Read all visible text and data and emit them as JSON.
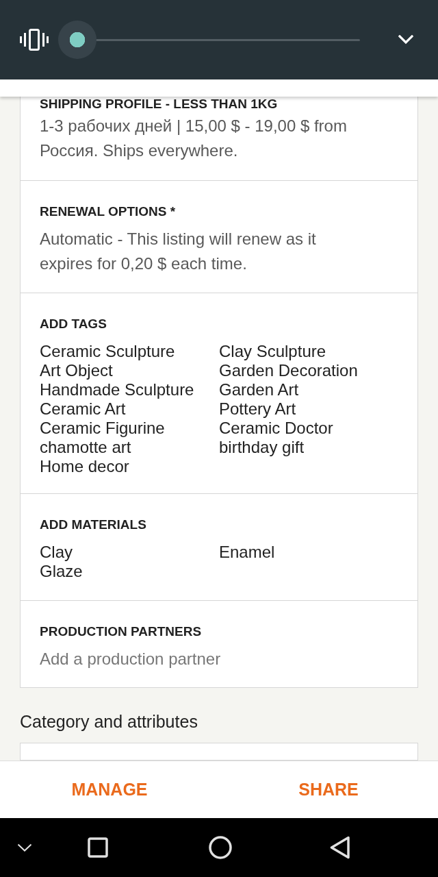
{
  "volume_panel": {
    "slider": {
      "level": 0
    }
  },
  "sections": [
    {
      "kind": "text",
      "heading": "SHIPPING PROFILE - LESS THAN 1KG",
      "text": "1-3 рабочих дней | 15,00 $ - 19,00 $ from Россия. Ships everywhere."
    },
    {
      "kind": "text",
      "heading": "RENEWAL OPTIONS *",
      "text": "Automatic - This listing will renew as it expires for 0,20 $ each time."
    },
    {
      "kind": "list",
      "heading": "ADD TAGS",
      "items": [
        "Ceramic Sculpture",
        "Art Object",
        "Handmade Sculpture",
        "Ceramic Art",
        "Ceramic Figurine",
        "chamotte art",
        "Home decor",
        "Clay Sculpture",
        "Garden Decoration",
        "Garden Art",
        "Pottery Art",
        "Ceramic Doctor",
        "birthday gift"
      ]
    },
    {
      "kind": "list",
      "heading": "ADD MATERIALS",
      "items": [
        "Clay",
        "Glaze",
        "Enamel"
      ]
    },
    {
      "kind": "prompt",
      "heading": "PRODUCTION PARTNERS",
      "prompt": "Add a production partner"
    }
  ],
  "category_heading": "Category and attributes",
  "actions": [
    "MANAGE",
    "SHARE"
  ]
}
